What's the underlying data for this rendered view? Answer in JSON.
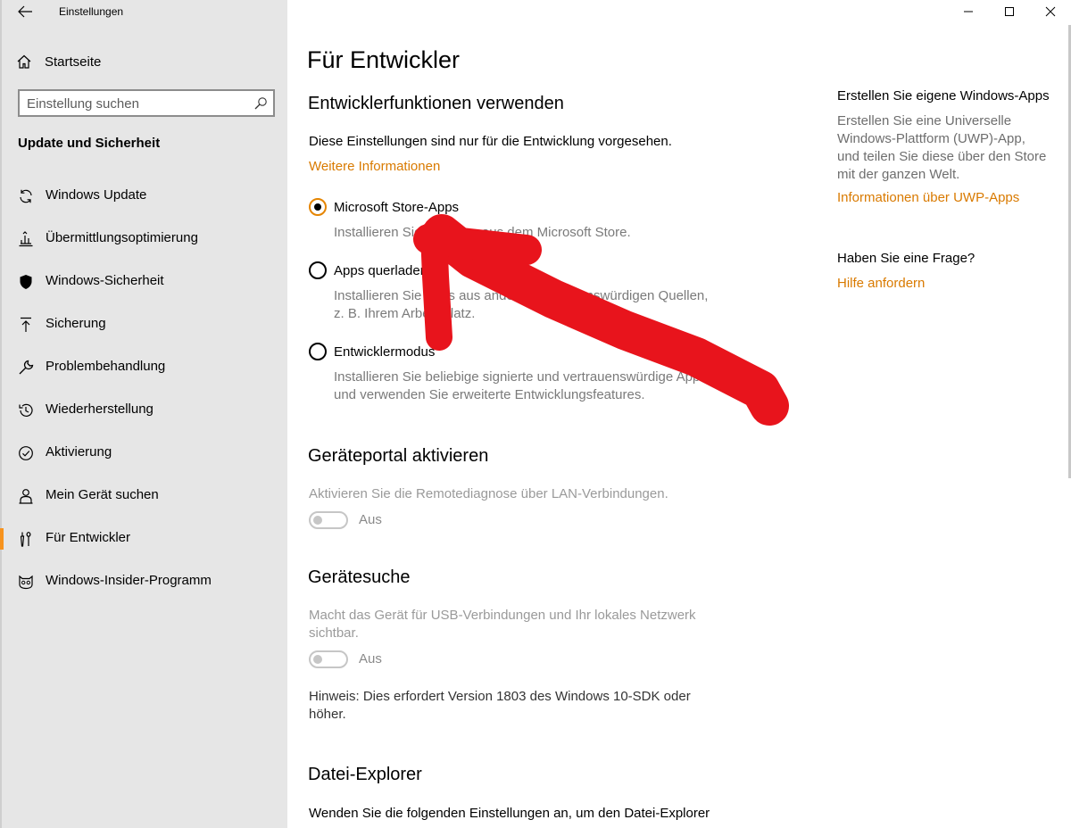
{
  "window": {
    "app_title": "Einstellungen",
    "controls": [
      "minimize",
      "maximize",
      "close"
    ]
  },
  "sidebar": {
    "home_label": "Startseite",
    "search_placeholder": "Einstellung suchen",
    "section_heading": "Update und Sicherheit",
    "items": [
      {
        "label": "Windows Update",
        "icon": "sync-icon",
        "active": false
      },
      {
        "label": "Übermittlungsoptimierung",
        "icon": "delivery-optimization-icon",
        "active": false
      },
      {
        "label": "Windows-Sicherheit",
        "icon": "shield-icon",
        "active": false
      },
      {
        "label": "Sicherung",
        "icon": "backup-upload-icon",
        "active": false
      },
      {
        "label": "Problembehandlung",
        "icon": "wrench-icon",
        "active": false
      },
      {
        "label": "Wiederherstellung",
        "icon": "history-icon",
        "active": false
      },
      {
        "label": "Aktivierung",
        "icon": "checkmark-circle-icon",
        "active": false
      },
      {
        "label": "Mein Gerät suchen",
        "icon": "person-locate-icon",
        "active": false
      },
      {
        "label": "Für Entwickler",
        "icon": "developer-tools-icon",
        "active": true
      },
      {
        "label": "Windows-Insider-Programm",
        "icon": "insider-cat-icon",
        "active": false
      }
    ],
    "accent_color": "#f7931e"
  },
  "main": {
    "page_title": "Für Entwickler",
    "dev_features": {
      "heading": "Entwicklerfunktionen verwenden",
      "description": "Diese Einstellungen sind nur für die Entwicklung vorgesehen.",
      "more_info_link": "Weitere Informationen",
      "options": [
        {
          "label": "Microsoft Store-Apps",
          "description": "Installieren Sie Apps nur aus dem Microsoft Store.",
          "checked": true
        },
        {
          "label": "Apps querladen",
          "description_1": "Installieren Sie Apps aus anderen vertrauenswürdigen Quellen,",
          "description_2": "z. B. Ihrem Arbeitsplatz.",
          "checked": false
        },
        {
          "label": "Entwicklermodus",
          "description_1": "Installieren Sie beliebige signierte und vertrauenswürdige Apps,",
          "description_2": "und verwenden Sie erweiterte Entwicklungsfeatures.",
          "checked": false
        }
      ]
    },
    "device_portal": {
      "heading": "Geräteportal aktivieren",
      "description": "Aktivieren Sie die Remotediagnose über LAN-Verbindungen.",
      "toggle_state": "Aus"
    },
    "device_discovery": {
      "heading": "Gerätesuche",
      "description_1": "Macht das Gerät für USB-Verbindungen und Ihr lokales Netzwerk",
      "description_2": "sichtbar.",
      "toggle_state": "Aus",
      "note_1": "Hinweis: Dies erfordert Version 1803 des Windows 10-SDK oder",
      "note_2": "höher."
    },
    "file_explorer": {
      "heading": "Datei-Explorer",
      "description": "Wenden Sie die folgenden Einstellungen an, um den Datei-Explorer"
    },
    "link_color": "#d97a00"
  },
  "aside": {
    "uwp_heading": "Erstellen Sie eigene Windows-Apps",
    "uwp_text_1": "Erstellen Sie eine Universelle",
    "uwp_text_2": "Windows-Plattform (UWP)-App,",
    "uwp_text_3": "und teilen Sie diese über den Store",
    "uwp_text_4": "mit der ganzen Welt.",
    "uwp_link": "Informationen über UWP-Apps",
    "question_heading": "Haben Sie eine Frage?",
    "help_link": "Hilfe anfordern"
  },
  "annotation": {
    "color": "#e8141c"
  }
}
